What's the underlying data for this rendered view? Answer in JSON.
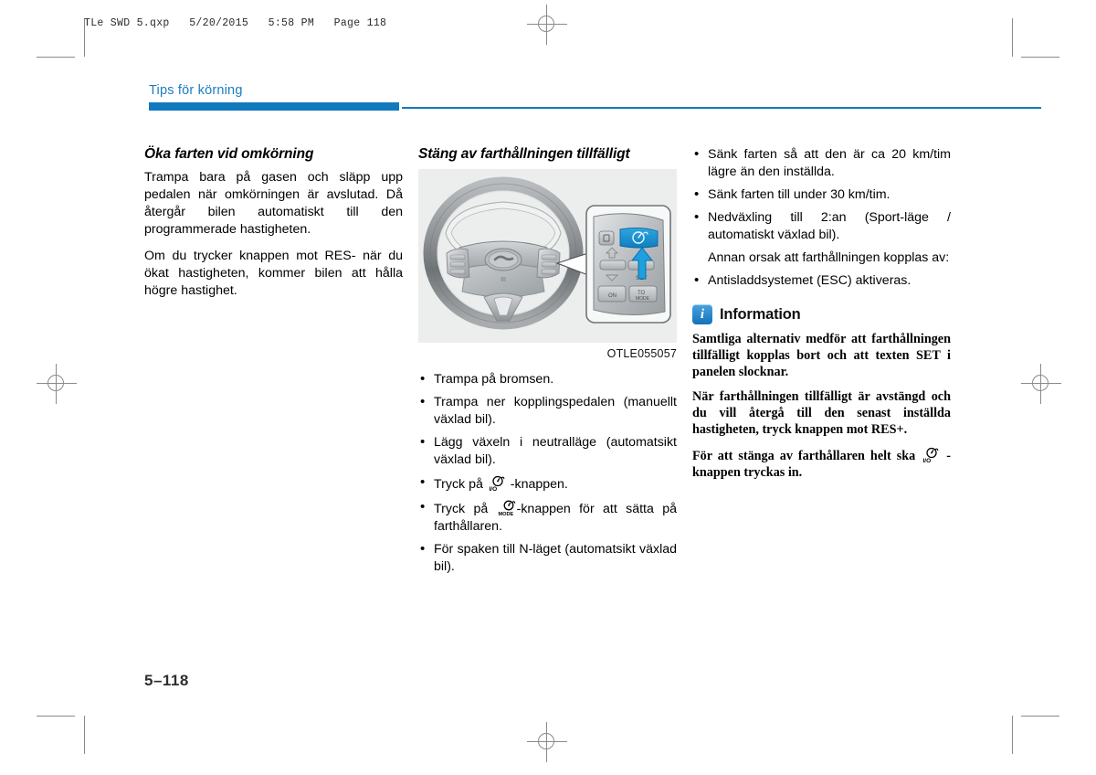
{
  "print_marks": {
    "file_header": "TLe SWD 5.qxp   5/20/2015   5:58 PM   Page 118"
  },
  "running_head": {
    "title": "Tips för körning",
    "accent_color": "#1279bd"
  },
  "column_left": {
    "heading": "Öka farten vid omkörning",
    "paragraphs": [
      "Trampa bara på gasen och släpp upp pedalen när omkörningen är avslutad. Då återgår bilen automatiskt till den programmerade hastigheten.",
      "Om du trycker knappen mot RES- när du ökat hastigheten, kommer bilen att hålla högre hastighet."
    ]
  },
  "column_middle": {
    "heading": "Stäng av farthållningen tillfälligt",
    "figure_caption": "OTLE055057",
    "bullets": [
      {
        "text_before": "Trampa på bromsen.",
        "icon": null,
        "text_after": ""
      },
      {
        "text_before": "Trampa ner kopplingspedalen (manuellt växlad bil).",
        "icon": null,
        "text_after": ""
      },
      {
        "text_before": "Lägg växeln i neutralläge (automatsikt växlad bil).",
        "icon": null,
        "text_after": ""
      },
      {
        "text_before": "Tryck på ",
        "icon": "cruise-io-icon",
        "icon_label": "I/O",
        "text_after": " -knappen."
      },
      {
        "text_before": "Tryck på ",
        "icon": "cruise-mode-icon",
        "icon_label": "MODE",
        "text_after": "-knappen för att sätta på farthållaren."
      },
      {
        "text_before": "För spaken till N-läget (automatsikt växlad bil).",
        "icon": null,
        "text_after": ""
      }
    ]
  },
  "column_right": {
    "bullets": [
      {
        "text": "Sänk farten så att den är ca 20 km/tim lägre än den inställda.",
        "bulleted": true
      },
      {
        "text": "Sänk farten till under 30 km/tim.",
        "bulleted": true
      },
      {
        "text": "Nedväxling till 2:an (Sport-läge / automatiskt växlad bil).",
        "bulleted": true
      },
      {
        "text": "Annan orsak att farthållningen kopplas av:",
        "bulleted": false
      },
      {
        "text": "Antisladdsystemet (ESC) aktiveras.",
        "bulleted": true
      }
    ],
    "info_box": {
      "icon_letter": "i",
      "title": "Information",
      "paragraphs": [
        {
          "text_before": "Samtliga alternativ medför att farthållningen tillfälligt kopplas bort och att texten SET i panelen slocknar.",
          "icon": null,
          "text_after": ""
        },
        {
          "text_before": "När farthållningen tillfälligt är avstängd och du vill återgå till den senast inställda hastigheten, tryck knappen mot RES+.",
          "icon": null,
          "text_after": ""
        },
        {
          "text_before": "För att stänga av farthållaren helt ska ",
          "icon": "cruise-io-icon",
          "icon_label": "I/O",
          "text_after": " -knappen tryckas in."
        }
      ]
    }
  },
  "folio": {
    "page_number": "5–118"
  }
}
